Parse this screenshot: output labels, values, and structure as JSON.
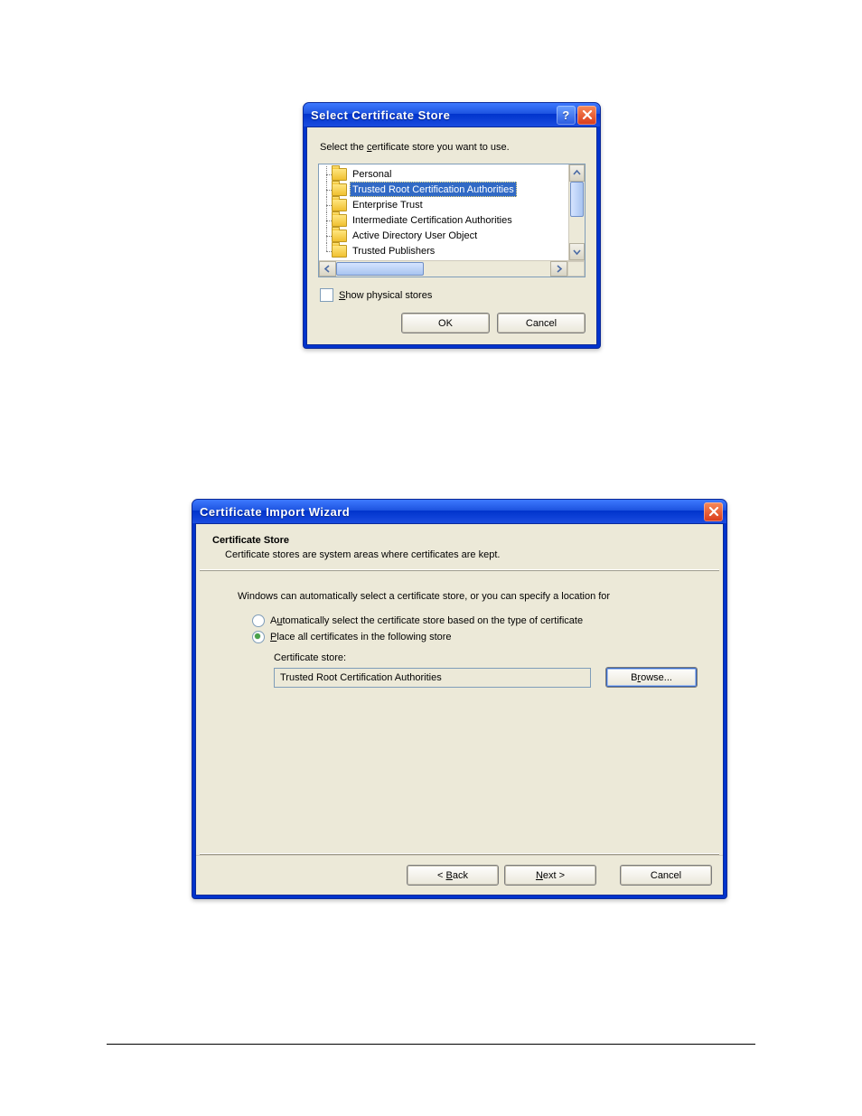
{
  "dlg1": {
    "title": "Select Certificate Store",
    "prompt_pre": "Select the ",
    "prompt_ul": "c",
    "prompt_post": "ertificate store you want to use.",
    "tree": [
      {
        "label": "Personal",
        "selected": false
      },
      {
        "label": "Trusted Root Certification Authorities",
        "selected": true
      },
      {
        "label": "Enterprise Trust",
        "selected": false
      },
      {
        "label": "Intermediate Certification Authorities",
        "selected": false
      },
      {
        "label": "Active Directory User Object",
        "selected": false
      },
      {
        "label": "Trusted Publishers",
        "selected": false
      }
    ],
    "show_physical_ul": "S",
    "show_physical_post": "how physical stores",
    "ok": "OK",
    "cancel": "Cancel"
  },
  "dlg2": {
    "title": "Certificate Import Wizard",
    "header_title": "Certificate Store",
    "header_sub": "Certificate stores are system areas where certificates are kept.",
    "body_text": "Windows can automatically select a certificate store, or you can specify a location for",
    "radio1_pre": "A",
    "radio1_ul": "u",
    "radio1_post": "tomatically select the certificate store based on the type of certificate",
    "radio2_ul": "P",
    "radio2_post": "lace all certificates in the following store",
    "store_label": "Certificate store:",
    "store_value": "Trusted Root Certification Authorities",
    "browse_pre": "B",
    "browse_ul": "r",
    "browse_post": "owse...",
    "back_pre": "< ",
    "back_ul": "B",
    "back_post": "ack",
    "next_ul": "N",
    "next_post": "ext >",
    "cancel": "Cancel"
  }
}
